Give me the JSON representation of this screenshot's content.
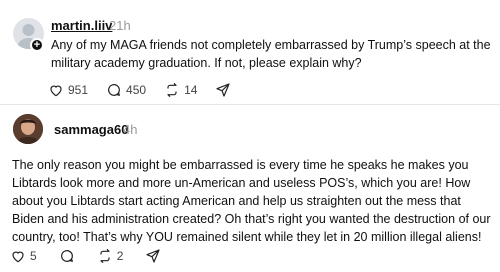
{
  "post1": {
    "username": "martin.liiv",
    "time": "21h",
    "text": "Any of my MAGA friends not completely embarrassed by Trump’s speech at the military academy graduation. If not, please explain why?",
    "likes": "951",
    "replies": "450",
    "reposts": "14",
    "icons": [
      "heart-icon",
      "comment-icon",
      "repost-icon",
      "share-icon"
    ]
  },
  "post2": {
    "username": "sammaga60",
    "time": "4h",
    "text": "The only reason you might be embarrassed is every time he speaks he makes you Libtards look more and more un-American and useless POS’s, which you are! How about you Libtards start acting American and help us straighten out the mess that Biden and his administration created? Oh that’s right you wanted the destruction of our country, too! That’s why YOU remained silent while they let in 20 million illegal aliens!",
    "likes": "5",
    "reposts": "2",
    "icons": [
      "heart-icon",
      "comment-icon",
      "repost-icon",
      "share-icon"
    ]
  },
  "colors": {
    "text": "#101010",
    "muted": "#999999",
    "divider": "#e6e6e6"
  }
}
